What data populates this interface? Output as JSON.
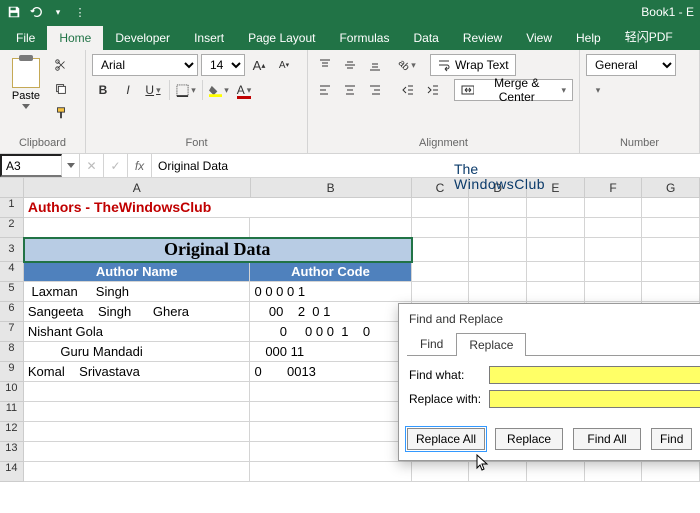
{
  "titlebar": {
    "bookname": "Book1 - E"
  },
  "tabs": {
    "file": "File",
    "home": "Home",
    "developer": "Developer",
    "insert": "Insert",
    "page_layout": "Page Layout",
    "formulas": "Formulas",
    "data": "Data",
    "review": "Review",
    "view": "View",
    "help": "Help",
    "addin": "轻闪PDF"
  },
  "ribbon": {
    "clipboard": {
      "paste": "Paste",
      "label": "Clipboard"
    },
    "font": {
      "name": "Arial",
      "size": "14",
      "bold": "B",
      "italic": "I",
      "underline": "U",
      "label": "Font"
    },
    "alignment": {
      "wrap": "Wrap Text",
      "merge": "Merge & Center",
      "label": "Alignment"
    },
    "number": {
      "format": "General",
      "label": "Number"
    }
  },
  "fxbar": {
    "namebox": "A3",
    "formula": "Original Data",
    "fx": "fx"
  },
  "columns": [
    "A",
    "B",
    "C",
    "D",
    "E",
    "F",
    "G"
  ],
  "sheet": {
    "title": "Authors - TheWindowsClub",
    "section_header": "Original Data",
    "col_a_header": "Author Name",
    "col_b_header": "Author Code",
    "rows": [
      {
        "n": 5,
        "a": " Laxman     Singh",
        "b": "0 0 0 0 1"
      },
      {
        "n": 6,
        "a": "Sangeeta    Singh      Ghera",
        "b": "    00    2  0 1"
      },
      {
        "n": 7,
        "a": "Nishant Gola",
        "b": "       0     0 0 0  1    0"
      },
      {
        "n": 8,
        "a": "         Guru Mandadi",
        "b": "   000 11"
      },
      {
        "n": 9,
        "a": "Komal    Srivastava",
        "b": "0       0013"
      }
    ],
    "blank_rows": [
      10,
      11,
      12,
      13,
      14
    ]
  },
  "watermark": {
    "l1": "The",
    "l2": "WindowsClub"
  },
  "dialog": {
    "title": "Find and Replace",
    "tab_find": "Find",
    "tab_replace": "Replace",
    "find_label": "Find what:",
    "replace_label": "Replace with:",
    "find_value": " ",
    "replace_value": "",
    "btn_replace_all": "Replace All",
    "btn_replace": "Replace",
    "btn_find_all": "Find All",
    "btn_find_next": "Find"
  }
}
